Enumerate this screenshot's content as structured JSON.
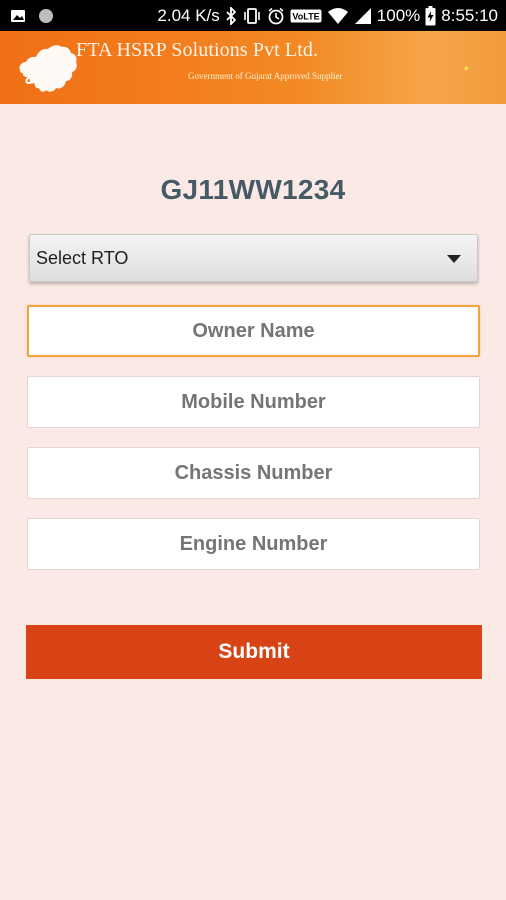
{
  "status_bar": {
    "network_speed": "2.04 K/s",
    "battery_percent": "100%",
    "time": "8:55:10",
    "volte_badge": "VoLTE",
    "icons": [
      "image-icon",
      "circle-notification-icon",
      "bluetooth-icon",
      "vibrate-icon",
      "alarm-icon",
      "volte-icon",
      "wifi-icon",
      "cellular-signal-icon",
      "battery-charging-icon"
    ]
  },
  "header": {
    "company_name": "FTA HSRP Solutions Pvt Ltd.",
    "tagline": "Government of Gujarat Approved Supplier",
    "logo": "gujarat-map-logo"
  },
  "vehicle": {
    "registration_number": "GJ11WW1234"
  },
  "form": {
    "rto_select": {
      "selected_label": "Select RTO"
    },
    "owner_name": {
      "placeholder": "Owner Name",
      "value": "",
      "focused": true
    },
    "mobile_number": {
      "placeholder": "Mobile Number",
      "value": ""
    },
    "chassis_number": {
      "placeholder": "Chassis Number",
      "value": ""
    },
    "engine_number": {
      "placeholder": "Engine Number",
      "value": ""
    },
    "submit_label": "Submit"
  },
  "colors": {
    "background": "#fbe9e6",
    "header_orange": "#f37d1d",
    "vehicle_number_text": "#455a64",
    "submit_button": "#d84315",
    "focus_border": "#f3a33e"
  }
}
